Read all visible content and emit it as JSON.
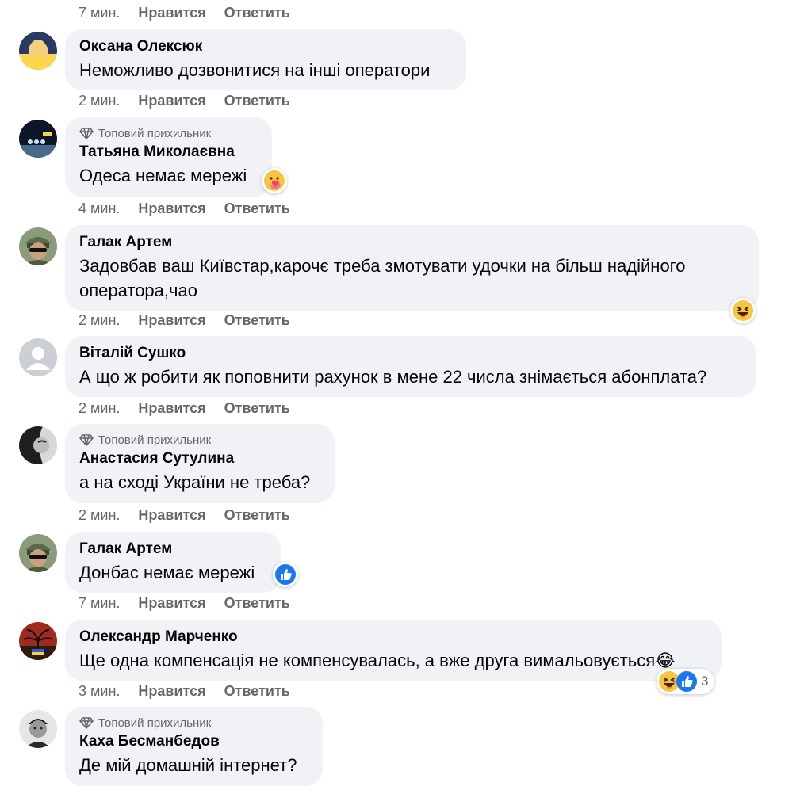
{
  "actions": {
    "like": "Нравится",
    "reply": "Ответить"
  },
  "badge_label": "Топовий прихильник",
  "comments": [
    {
      "time": "7 мин."
    },
    {
      "name": "Оксана Олексюк",
      "text": "Неможливо дозвонитися на інші оператори",
      "time": "2 мин."
    },
    {
      "name": "Татьяна Миколаєвна",
      "text": "Одеса немає мережі",
      "time": "4 мин."
    },
    {
      "name": "Галак Артем",
      "text": "Задовбав ваш Київстар,карочє треба змотувати удочки на більш надійного оператора,чао",
      "time": "2 мин."
    },
    {
      "name": "Віталій Сушко",
      "text": "А що ж робити як поповнити рахунок в мене 22 числа знімається абонплата?",
      "time": "2 мин."
    },
    {
      "name": "Анастасия Сутулина",
      "text": "а на сході України не треба?",
      "time": "2 мин."
    },
    {
      "name": "Галак Артем",
      "text": "Донбас немає мережі",
      "time": "7 мин."
    },
    {
      "name": "Олександр Марченко",
      "text": "Ще одна компенсація не компенсувалась, а вже друга вимальовується😂",
      "time": "3 мин.",
      "reaction_count": "3"
    },
    {
      "name": "Каха Бесманбедов",
      "text": "Де мій домашній інтернет?"
    }
  ]
}
